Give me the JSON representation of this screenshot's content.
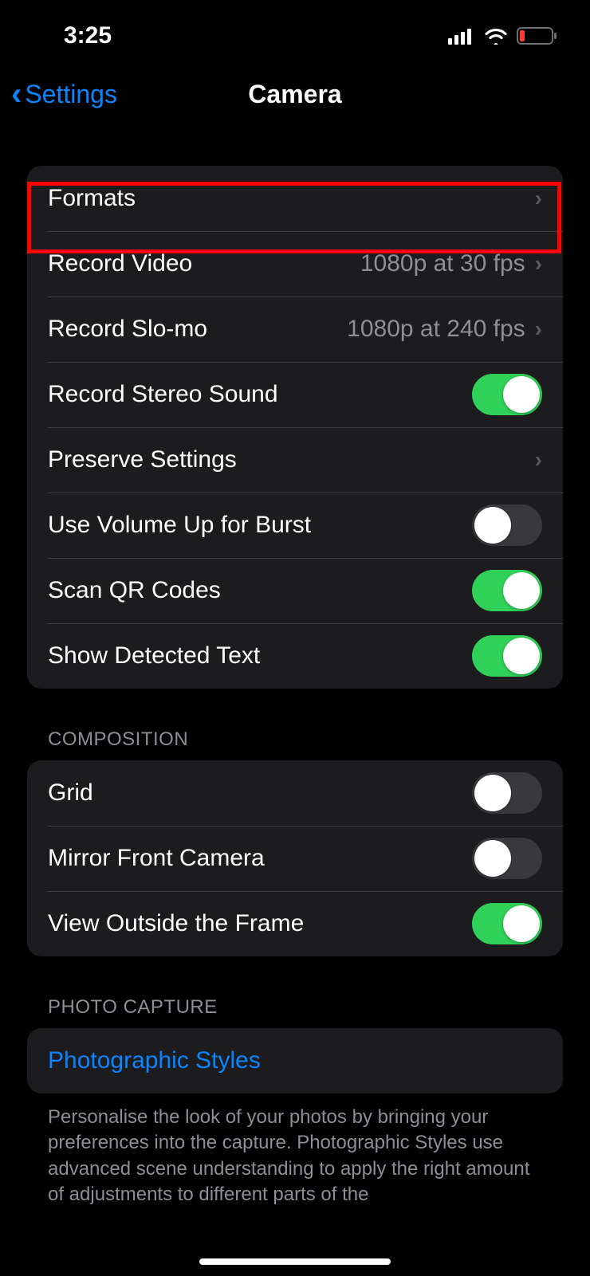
{
  "status": {
    "time": "3:25"
  },
  "nav": {
    "back": "Settings",
    "title": "Camera"
  },
  "group1": {
    "rows": [
      {
        "label": "Formats",
        "type": "nav"
      },
      {
        "label": "Record Video",
        "value": "1080p at 30 fps",
        "type": "nav"
      },
      {
        "label": "Record Slo-mo",
        "value": "1080p at 240 fps",
        "type": "nav"
      },
      {
        "label": "Record Stereo Sound",
        "type": "toggle",
        "on": true
      },
      {
        "label": "Preserve Settings",
        "type": "nav"
      },
      {
        "label": "Use Volume Up for Burst",
        "type": "toggle",
        "on": false
      },
      {
        "label": "Scan QR Codes",
        "type": "toggle",
        "on": true
      },
      {
        "label": "Show Detected Text",
        "type": "toggle",
        "on": true
      }
    ]
  },
  "section_composition": "COMPOSITION",
  "group2": {
    "rows": [
      {
        "label": "Grid",
        "type": "toggle",
        "on": false
      },
      {
        "label": "Mirror Front Camera",
        "type": "toggle",
        "on": false
      },
      {
        "label": "View Outside the Frame",
        "type": "toggle",
        "on": true
      }
    ]
  },
  "section_photo": "PHOTO CAPTURE",
  "group3": {
    "rows": [
      {
        "label": "Photographic Styles",
        "type": "link"
      }
    ]
  },
  "footer": "Personalise the look of your photos by bringing your preferences into the capture. Photographic Styles use advanced scene understanding to apply the right amount of adjustments to different parts of the"
}
